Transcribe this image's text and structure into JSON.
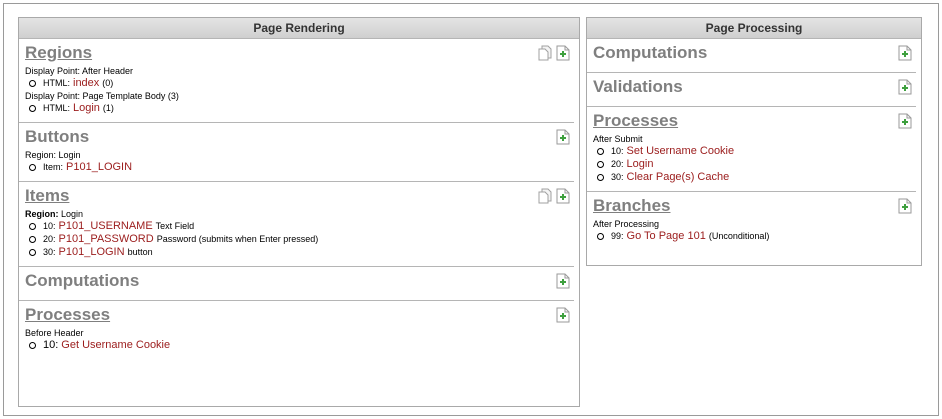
{
  "rendering": {
    "header": "Page Rendering",
    "regions": {
      "title": "Regions",
      "groups": [
        {
          "label": "Display Point: After Header",
          "item_prefix": "HTML:",
          "item_link": "index",
          "item_suffix": "(0)"
        },
        {
          "label": "Display Point: Page Template Body (3)",
          "item_prefix": "HTML:",
          "item_link": "Login",
          "item_suffix": "(1)"
        }
      ]
    },
    "buttons": {
      "title": "Buttons",
      "label": "Region: Login",
      "item_prefix": "Item:",
      "item_link": "P101_LOGIN"
    },
    "items": {
      "title": "Items",
      "label_bold": "Region:",
      "label_rest": "Login",
      "rows": [
        {
          "prefix": "10:",
          "link": "P101_USERNAME",
          "suffix": "Text Field"
        },
        {
          "prefix": "20:",
          "link": "P101_PASSWORD",
          "suffix": "Password (submits when Enter pressed)"
        },
        {
          "prefix": "30:",
          "link": "P101_LOGIN",
          "suffix": "button"
        }
      ]
    },
    "computations": {
      "title": "Computations"
    },
    "processes": {
      "title": "Processes",
      "label": "Before Header",
      "item_prefix": "10:",
      "item_link": "Get Username Cookie"
    }
  },
  "processing": {
    "header": "Page Processing",
    "computations": {
      "title": "Computations"
    },
    "validations": {
      "title": "Validations"
    },
    "processes": {
      "title": "Processes",
      "label": "After Submit",
      "rows": [
        {
          "prefix": "10:",
          "link": "Set Username Cookie"
        },
        {
          "prefix": "20:",
          "link": "Login"
        },
        {
          "prefix": "30:",
          "link": "Clear Page(s) Cache"
        }
      ]
    },
    "branches": {
      "title": "Branches",
      "label": "After Processing",
      "item_prefix": "99:",
      "item_link": "Go To Page  101",
      "item_suffix": "(Unconditional)"
    }
  },
  "icons": {
    "copy": "copy-icon",
    "add": "add-icon"
  }
}
